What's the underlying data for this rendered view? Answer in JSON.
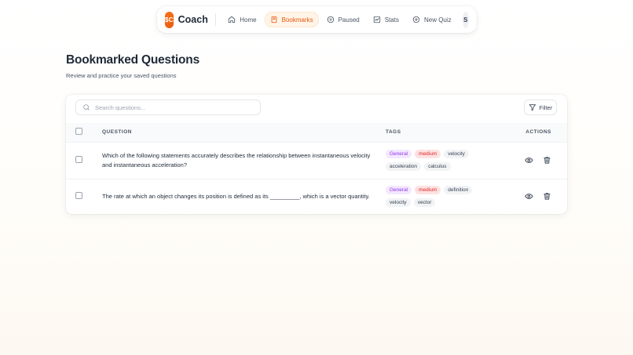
{
  "nav": {
    "logo": "$C",
    "brand": "Coach",
    "items": [
      {
        "label": "Home",
        "icon": "home-icon",
        "active": false
      },
      {
        "label": "Bookmarks",
        "icon": "bookmark-icon",
        "active": true
      },
      {
        "label": "Paused",
        "icon": "pause-icon",
        "active": false
      },
      {
        "label": "Stats",
        "icon": "stats-icon",
        "active": false
      },
      {
        "label": "New Quiz",
        "icon": "plus-circle-icon",
        "active": false
      }
    ],
    "avatar": "S"
  },
  "page": {
    "title": "Bookmarked Questions",
    "subtitle": "Review and practice your saved questions"
  },
  "search": {
    "placeholder": "Search questions..."
  },
  "filter": {
    "label": "Filter"
  },
  "table": {
    "headers": {
      "question": "QUESTION",
      "tags": "TAGS",
      "actions": "ACTIONS"
    },
    "rows": [
      {
        "question": "Which of the following statements accurately describes the relationship between instantaneous velocity and instantaneous acceleration?",
        "tags": [
          "General",
          "medium",
          "velocity",
          "acceleration",
          "calculus"
        ]
      },
      {
        "question": "The rate at which an object changes its position is defined as its _________, which is a vector quantity.",
        "tags": [
          "General",
          "medium",
          "definition",
          "velocity",
          "vector"
        ]
      }
    ]
  },
  "colors": {
    "accent": "#ea580c",
    "subject_tag": "#9333ea",
    "difficulty_tag": "#dc2626"
  }
}
